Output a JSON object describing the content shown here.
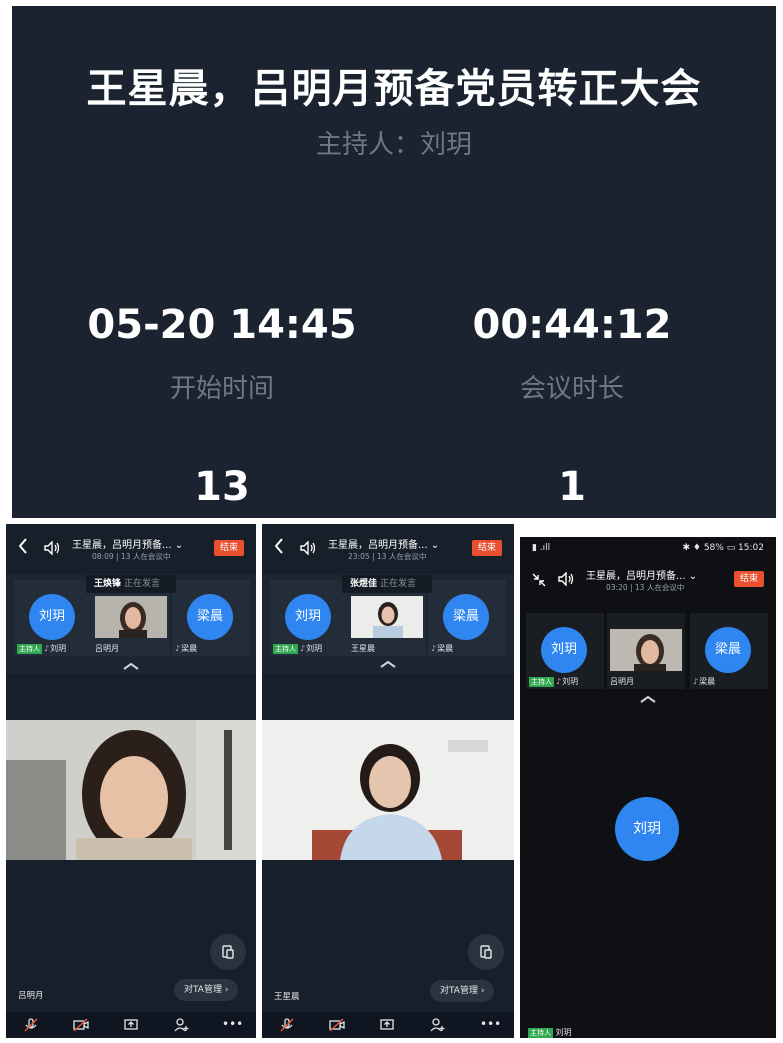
{
  "summary": {
    "title": "王星晨，吕明月预备党员转正大会",
    "host": "主持人：刘玥",
    "start_value": "05-20 14:45",
    "start_label": "开始时间",
    "duration_value": "00:44:12",
    "duration_label": "会议时长",
    "count1": "13",
    "count2": "1"
  },
  "phones": [
    {
      "title": "王星晨，吕明月预备...",
      "sub": "08:09 | 13 人在会议中",
      "end": "结束",
      "speaking_name": "王焕锋",
      "speaking_status": "正在发言",
      "tiles": [
        {
          "avatar": "刘玥",
          "host_tag": "主持人",
          "name": "刘玥"
        },
        {
          "name": "吕明月"
        },
        {
          "avatar": "梁晨",
          "name": "梁晨"
        }
      ],
      "video_name": "吕明月",
      "manage": "对TA管理 ›"
    },
    {
      "title": "王星晨，吕明月预备...",
      "sub": "23:05 | 13 人在会议中",
      "end": "结束",
      "speaking_name": "张煜佳",
      "speaking_status": "正在发言",
      "tiles": [
        {
          "avatar": "刘玥",
          "host_tag": "主持人",
          "name": "刘玥"
        },
        {
          "name": "王星晨"
        },
        {
          "avatar": "梁晨",
          "name": "梁晨"
        }
      ],
      "video_name": "王星晨",
      "manage": "对TA管理 ›"
    },
    {
      "status_left": "▮ .ıll",
      "status_right": "✱ ♦ 58% ▭ 15:02",
      "title": "王星晨，吕明月预备...",
      "sub": "03:20 | 13 人在会议中",
      "end": "结束",
      "tiles": [
        {
          "avatar": "刘玥",
          "host_tag": "主持人",
          "name": "刘玥"
        },
        {
          "name": "吕明月"
        },
        {
          "avatar": "梁晨",
          "name": "梁晨"
        }
      ],
      "big_avatar": "刘玥",
      "foot_host": "主持人",
      "foot_name": "刘玥"
    }
  ],
  "colors": {
    "accent": "#2f86f0",
    "end": "#e8502f",
    "host": "#2fa84f",
    "bg": "#1b2330"
  },
  "icons": [
    "back-icon",
    "speaker-icon",
    "collapse-icon",
    "chevron-up-icon",
    "screen-share-icon",
    "mic-off-icon",
    "camera-off-icon",
    "share-icon",
    "add-member-icon",
    "more-icon"
  ]
}
